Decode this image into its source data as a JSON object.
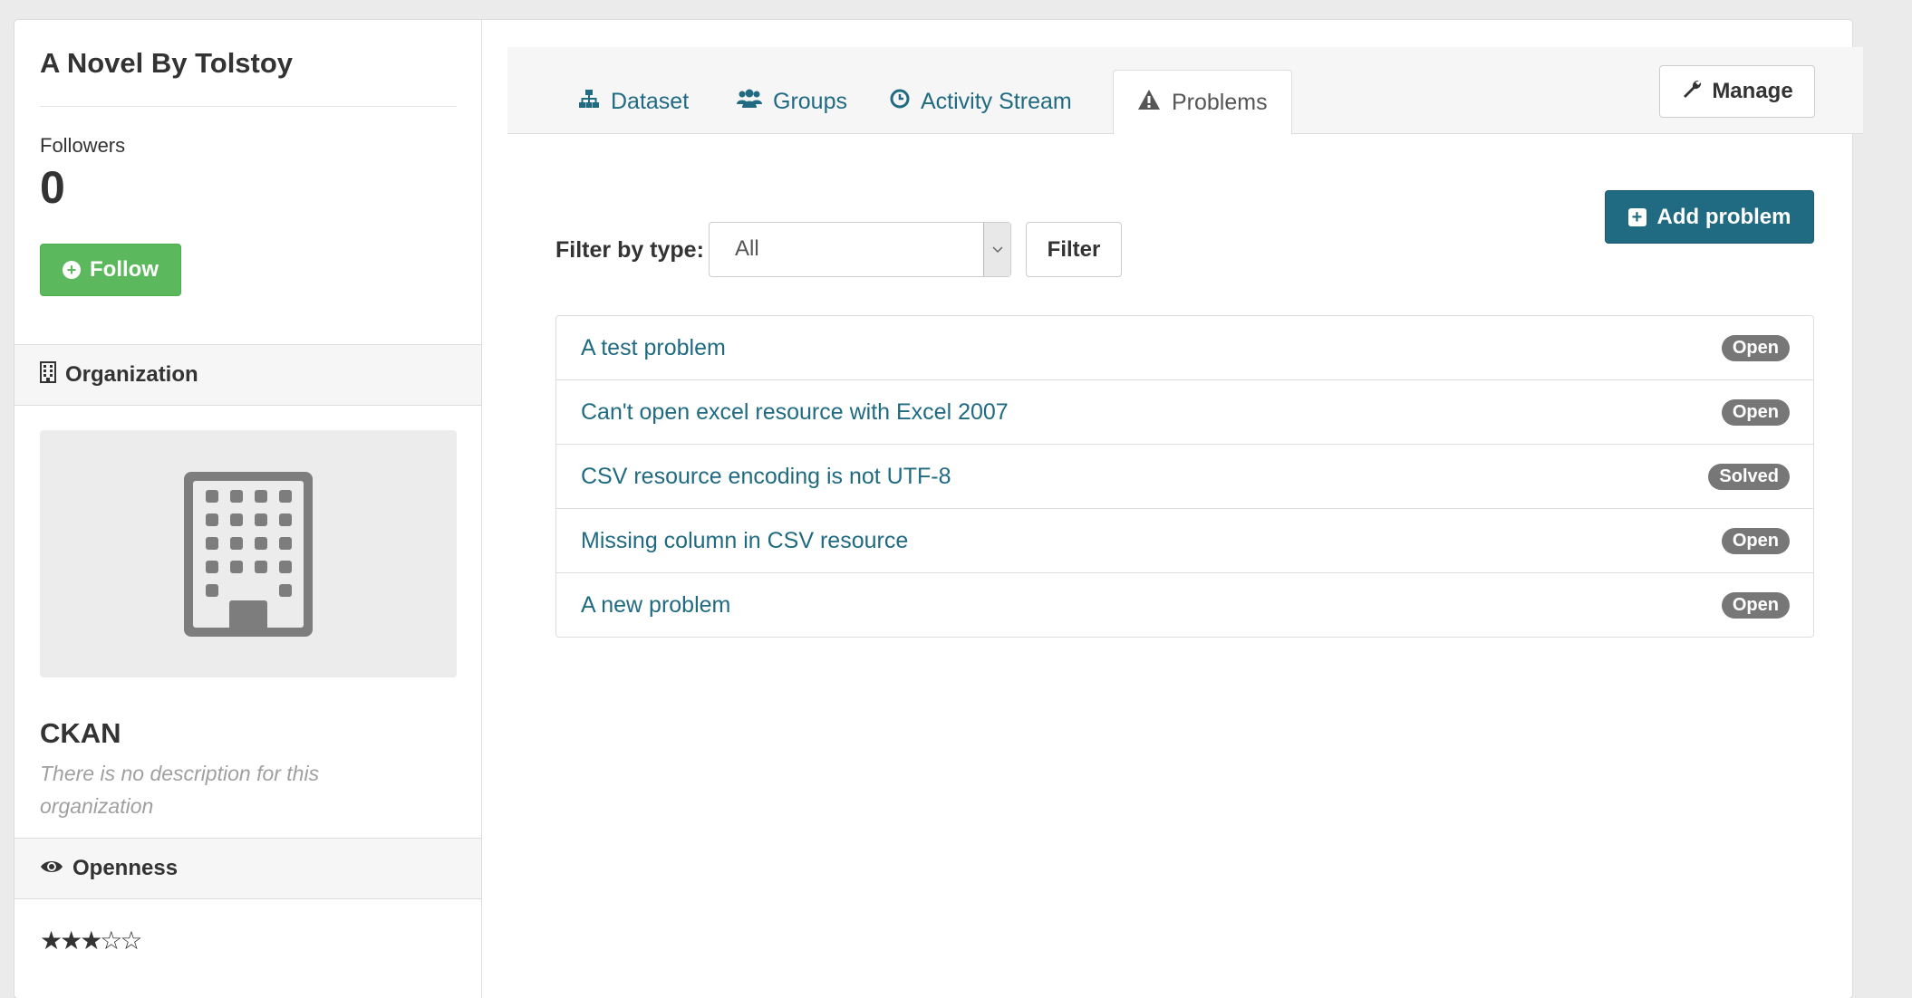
{
  "dataset": {
    "title": "A Novel By Tolstoy"
  },
  "followers": {
    "label": "Followers",
    "count": "0",
    "follow_label": "Follow"
  },
  "organization": {
    "heading": "Organization",
    "name": "CKAN",
    "description": "There is no description for this organization"
  },
  "openness": {
    "heading": "Openness",
    "stars": "★★★☆☆",
    "rating": 3,
    "max": 5
  },
  "tabs": [
    {
      "label": "Dataset",
      "icon": "sitemap-icon",
      "active": false
    },
    {
      "label": "Groups",
      "icon": "users-icon",
      "active": false
    },
    {
      "label": "Activity Stream",
      "icon": "clock-icon",
      "active": false
    },
    {
      "label": "Problems",
      "icon": "warning-icon",
      "active": true
    }
  ],
  "actions": {
    "manage_label": "Manage",
    "add_problem_label": "Add problem"
  },
  "filter": {
    "label": "Filter by type:",
    "selected": "All",
    "button_label": "Filter"
  },
  "problems": [
    {
      "title": "A test problem",
      "status": "Open"
    },
    {
      "title": "Can't open excel resource with Excel 2007",
      "status": "Open"
    },
    {
      "title": "CSV resource encoding is not UTF-8",
      "status": "Solved"
    },
    {
      "title": "Missing column in CSV resource",
      "status": "Open"
    },
    {
      "title": "A new problem",
      "status": "Open"
    }
  ],
  "colors": {
    "link": "#206b82",
    "primary": "#206b82",
    "success": "#5cb85c",
    "badge": "#777777"
  }
}
